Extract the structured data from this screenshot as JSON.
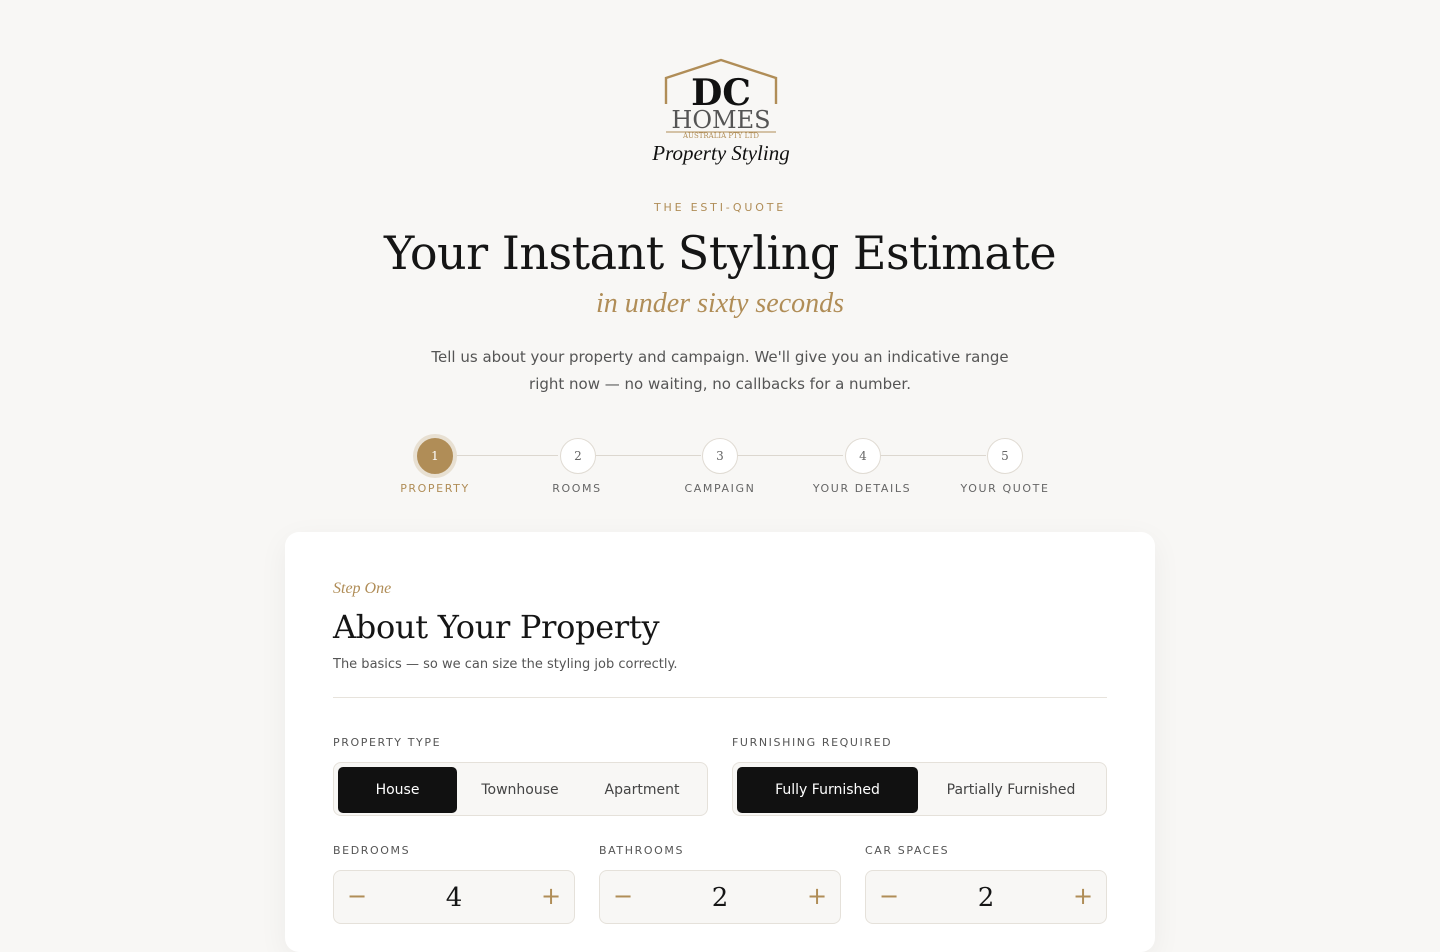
{
  "brand": {
    "logo_mark": "DC",
    "logo_word": "HOMES",
    "logo_sub": "AUSTRALIA PTY LTD",
    "logo_script": "Property Styling"
  },
  "hero": {
    "eyebrow": "THE ESTI-QUOTE",
    "title": "Your Instant Styling Estimate",
    "script": "in under sixty seconds",
    "intro_line1": "Tell us about your property and campaign. We'll give you an indicative range",
    "intro_line2": "right now — no waiting, no callbacks for a number."
  },
  "steps": [
    {
      "number": "1",
      "label": "PROPERTY",
      "active": true
    },
    {
      "number": "2",
      "label": "ROOMS",
      "active": false
    },
    {
      "number": "3",
      "label": "CAMPAIGN",
      "active": false
    },
    {
      "number": "4",
      "label": "YOUR DETAILS",
      "active": false
    },
    {
      "number": "5",
      "label": "YOUR QUOTE",
      "active": false
    }
  ],
  "form": {
    "kicker": "Step One",
    "title": "About Your Property",
    "subtitle": "The basics — so we can size the styling job correctly.",
    "property_type": {
      "label": "PROPERTY TYPE",
      "options": [
        "House",
        "Townhouse",
        "Apartment"
      ],
      "selected": "House"
    },
    "furnishing": {
      "label": "FURNISHING REQUIRED",
      "options": [
        "Fully Furnished",
        "Partially Furnished"
      ],
      "selected": "Fully Furnished"
    },
    "bedrooms": {
      "label": "BEDROOMS",
      "value": "4"
    },
    "bathrooms": {
      "label": "BATHROOMS",
      "value": "2"
    },
    "car_spaces": {
      "label": "CAR SPACES",
      "value": "2"
    },
    "minus_symbol": "−",
    "plus_symbol": "+"
  },
  "colors": {
    "accent": "#b08d57",
    "background": "#f8f7f5",
    "selected": "#111111"
  }
}
